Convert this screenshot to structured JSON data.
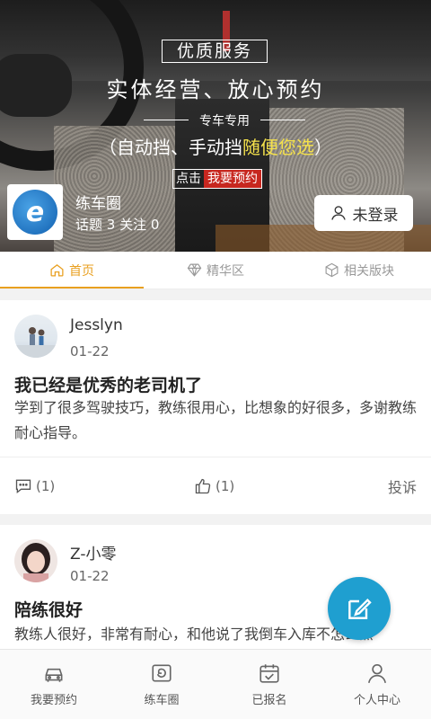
{
  "banner": {
    "tag": "优质服务",
    "headline": "实体经营、放心预约",
    "subline": "专车专用",
    "modes_prefix": "（自动挡、手动挡",
    "modes_highlight": "随便您选",
    "modes_suffix": "）",
    "cta_prefix": "点击",
    "cta_button": "我要预约"
  },
  "forum": {
    "name": "练车圈",
    "stats": "话题 3 关注 0",
    "login_label": "未登录",
    "logo_icon": "e-logo"
  },
  "tabs": [
    {
      "label": "首页",
      "icon": "home-icon",
      "active": true
    },
    {
      "label": "精华区",
      "icon": "diamond-icon",
      "active": false
    },
    {
      "label": "相关版块",
      "icon": "cube-icon",
      "active": false
    }
  ],
  "posts": [
    {
      "author": "Jesslyn",
      "date": "01-22",
      "title": "我已经是优秀的老司机了",
      "body": "学到了很多驾驶技巧，教练很用心，比想象的好很多，多谢教练耐心指导。",
      "comments": "(1)",
      "likes": "(1)",
      "report": "投诉"
    },
    {
      "author": "Z-小零",
      "date": "01-22",
      "title": "陪练很好",
      "body": "教练人很好，非常有耐心，和他说了我倒车入库不怎么熟"
    }
  ],
  "nav": [
    {
      "label": "我要预约",
      "icon": "car-icon"
    },
    {
      "label": "练车圈",
      "icon": "circle-icon"
    },
    {
      "label": "已报名",
      "icon": "calendar-check-icon"
    },
    {
      "label": "个人中心",
      "icon": "user-icon"
    }
  ],
  "colors": {
    "accent": "#e9a020",
    "fab": "#1f9fd0",
    "cta_red": "#c7271f",
    "highlight": "#f5e24c"
  }
}
